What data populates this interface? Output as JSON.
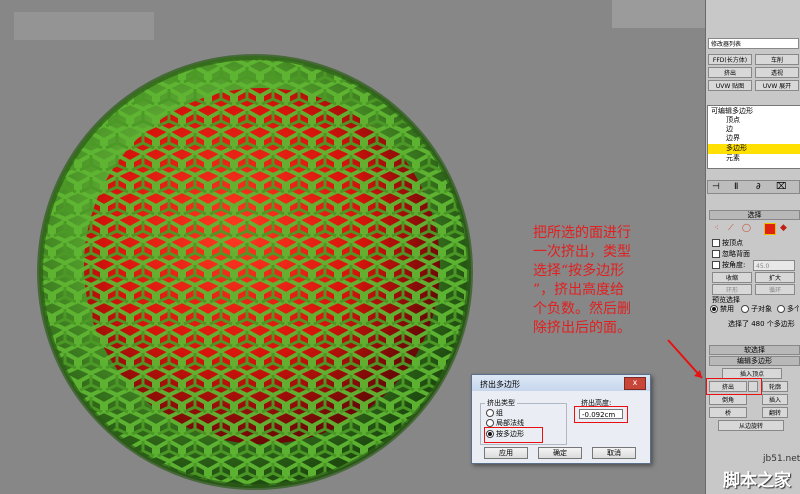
{
  "annotation": {
    "lines": [
      "把所选的面进行",
      "一次挤出，类型",
      "选择“按多边形",
      "”，挤出高度给",
      "个负数。然后删",
      "除挤出后的面。"
    ]
  },
  "panel": {
    "modifier_list": "修改器列表",
    "buttons_row1": [
      "FFD(长方体)",
      "车削"
    ],
    "buttons_row2": [
      "挤出",
      "透视"
    ],
    "buttons_row3": [
      "UVW 贴图",
      "UVW 展开"
    ],
    "tree": {
      "root": "可编辑多边形",
      "items": [
        "顶点",
        "边",
        "边界",
        "多边形",
        "元素"
      ],
      "selected_index": 3
    },
    "selection": {
      "header": "选择",
      "by_vertex": "按顶点",
      "ignore_backface": "忽略背面",
      "by_angle": "按角度:",
      "angle_value": "45.0",
      "shrink": "收缩",
      "grow": "扩大",
      "ring": "环形",
      "loop": "循环",
      "preview_header": "预览选择",
      "preview_options": [
        "禁用",
        "子对象",
        "多个"
      ],
      "status": "选择了 480 个多边形"
    },
    "soft_selection": "软选择",
    "edit_polygons": "编辑多边形",
    "insert_vertex": "插入顶点",
    "ops_row1": [
      "挤出",
      "轮廓"
    ],
    "ops_row2": [
      "倒角",
      "插入"
    ],
    "ops_row3": [
      "桥",
      "翻转"
    ],
    "from_edge": "从边旋转"
  },
  "dialog": {
    "title": "挤出多边形",
    "close": "x",
    "group_type": "挤出类型",
    "type_options": [
      "组",
      "局部法线",
      "按多边形"
    ],
    "type_selected": 2,
    "group_height": "挤出高度:",
    "height_value": "-0.092cm",
    "buttons": [
      "应用",
      "确定",
      "取消"
    ]
  },
  "watermark": {
    "site": "jb51.net",
    "name": "脚本之家"
  },
  "colors": {
    "viewport_bg": "#878787",
    "face_red": "#e8160e",
    "frame_green": "#5fa832",
    "annotation_red": "#e02020"
  }
}
